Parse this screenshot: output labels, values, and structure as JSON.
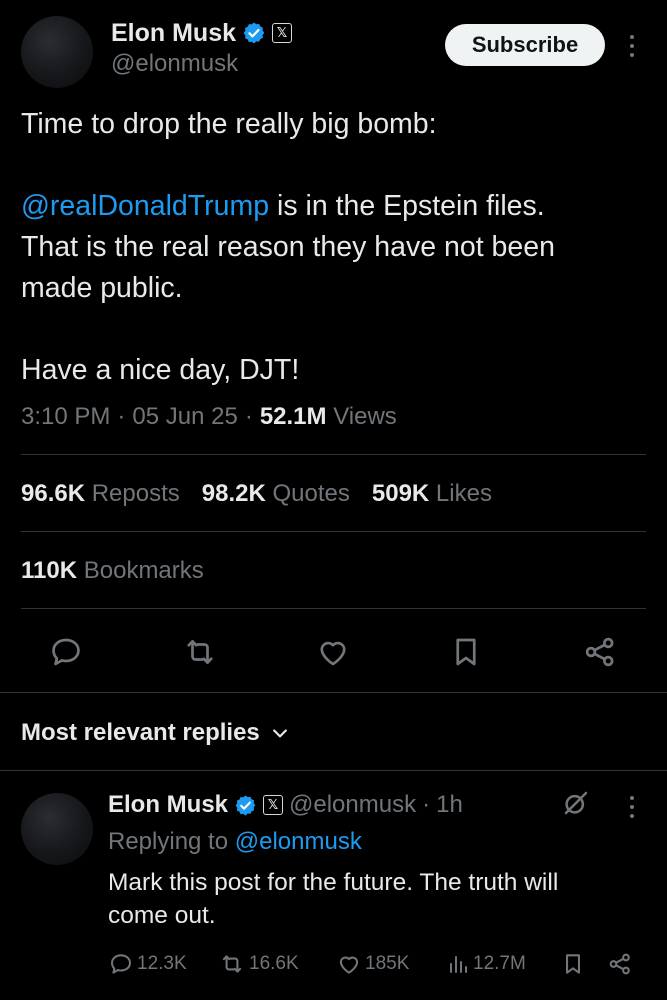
{
  "post": {
    "author_name": "Elon Musk",
    "badge_x": "𝕏",
    "handle": "@elonmusk",
    "subscribe_label": "Subscribe",
    "line1": "Time to drop the really big bomb:",
    "mention": "@realDonaldTrump",
    "line2_rest": " is in the Epstein files.",
    "line3": "That is the real reason they have not been",
    "line4": "made public.",
    "line5": "Have a nice day, DJT!",
    "time": "3:10 PM",
    "sep": "·",
    "date": "05 Jun 25",
    "views_count": "52.1M",
    "views_label": "Views"
  },
  "stats": {
    "reposts_count": "96.6K",
    "reposts_label": "Reposts",
    "quotes_count": "98.2K",
    "quotes_label": "Quotes",
    "likes_count": "509K",
    "likes_label": "Likes",
    "bookmarks_count": "110K",
    "bookmarks_label": "Bookmarks"
  },
  "actions": [
    "reply-icon",
    "repost-icon",
    "like-icon",
    "bookmark-icon",
    "share-icon"
  ],
  "replies_filter": {
    "label": "Most relevant replies"
  },
  "reply": {
    "author_name": "Elon Musk",
    "badge_x": "𝕏",
    "handle": "@elonmusk",
    "sep": "·",
    "age": "1h",
    "replying_prefix": "Replying to",
    "replying_handle": "@elonmusk",
    "text_line1": "Mark this post for the future. The truth will",
    "text_line2": "come out.",
    "replies": "12.3K",
    "reposts": "16.6K",
    "likes": "185K",
    "views": "12.7M"
  },
  "colors": {
    "accent": "#1d9bf0",
    "background": "#000000",
    "text": "#e7e9ea",
    "muted": "#71767b",
    "verified": "#1d9bf0"
  }
}
